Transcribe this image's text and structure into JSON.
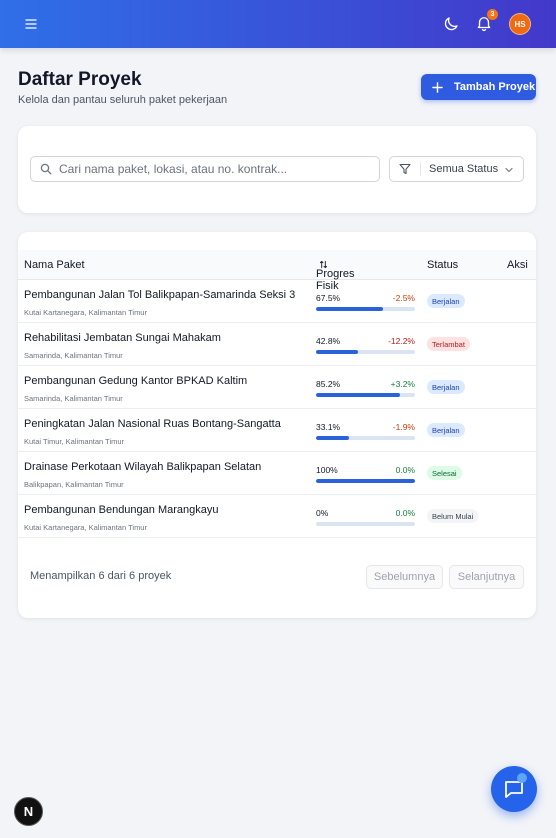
{
  "header": {
    "notification_count": "3",
    "user_initials": "HS"
  },
  "page": {
    "title": "Daftar Proyek",
    "subtitle": "Kelola dan pantau seluruh paket pekerjaan",
    "add_button": "Tambah Proyek"
  },
  "filters": {
    "search_placeholder": "Cari nama paket, lokasi, atau no. kontrak...",
    "status_selected": "Semua Status"
  },
  "table": {
    "columns": {
      "name": "Nama Paket",
      "progress": "Progres Fisik",
      "status": "Status",
      "action": "Aksi"
    },
    "rows": [
      {
        "name": "Pembangunan Jalan Tol Balikpapan-Samarinda Seksi 3",
        "location": "Kutai Kartanegara, Kalimantan Timur",
        "progress_label": "67.5%",
        "progress": 67.5,
        "deviation": "-2.5%",
        "deviation_color": "#c2410c",
        "status": "Berjalan",
        "status_bg": "#dbeafe",
        "status_color": "#1e40af"
      },
      {
        "name": "Rehabilitasi Jembatan Sungai Mahakam",
        "location": "Samarinda, Kalimantan Timur",
        "progress_label": "42.8%",
        "progress": 42.8,
        "deviation": "-12.2%",
        "deviation_color": "#b91c1c",
        "status": "Terlambat",
        "status_bg": "#fee2e2",
        "status_color": "#b91c1c"
      },
      {
        "name": "Pembangunan Gedung Kantor BPKAD Kaltim",
        "location": "Samarinda, Kalimantan Timur",
        "progress_label": "85.2%",
        "progress": 85.2,
        "deviation": "+3.2%",
        "deviation_color": "#15803d",
        "status": "Berjalan",
        "status_bg": "#dbeafe",
        "status_color": "#1e40af"
      },
      {
        "name": "Peningkatan Jalan Nasional Ruas Bontang-Sangatta",
        "location": "Kutai Timur, Kalimantan Timur",
        "progress_label": "33.1%",
        "progress": 33.1,
        "deviation": "-1.9%",
        "deviation_color": "#c2410c",
        "status": "Berjalan",
        "status_bg": "#dbeafe",
        "status_color": "#1e40af"
      },
      {
        "name": "Drainase Perkotaan Wilayah Balikpapan Selatan",
        "location": "Balikpapan, Kalimantan Timur",
        "progress_label": "100%",
        "progress": 100,
        "deviation": "0.0%",
        "deviation_color": "#15803d",
        "status": "Selesai",
        "status_bg": "#dcfce7",
        "status_color": "#166534"
      },
      {
        "name": "Pembangunan Bendungan Marangkayu",
        "location": "Kutai Kartanegara, Kalimantan Timur",
        "progress_label": "0%",
        "progress": 0,
        "deviation": "0.0%",
        "deviation_color": "#15803d",
        "status": "Belum Mulai",
        "status_bg": "#f3f4f6",
        "status_color": "#374151"
      }
    ]
  },
  "pagination": {
    "info": "Menampilkan 6 dari 6 proyek",
    "prev": "Sebelumnya",
    "next": "Selanjutnya"
  },
  "floating": {
    "framework_badge": "N"
  },
  "colors": {
    "primary": "#2f5be0",
    "progress_fill": "#2a62d9"
  }
}
